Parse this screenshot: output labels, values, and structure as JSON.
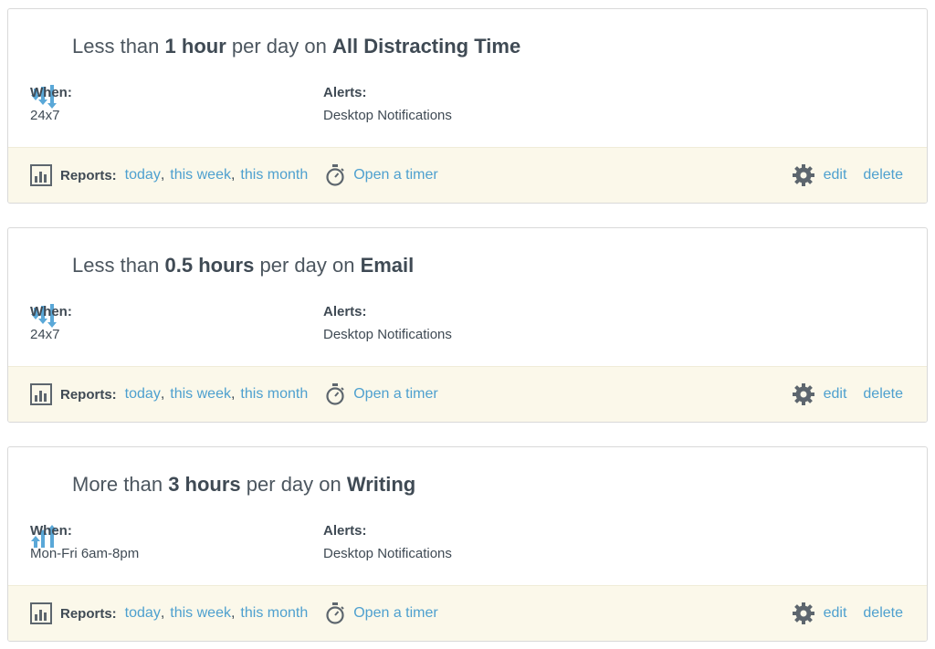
{
  "colors": {
    "accent_link": "#4ea0cf",
    "footer_bg": "#fbf8ea",
    "icon_blue": "#5aa8d8",
    "icon_gray": "#5d666e"
  },
  "footer": {
    "reports_label": "Reports:",
    "today": "today",
    "this_week": "this week",
    "this_month": "this month",
    "comma": ",",
    "open_timer": "Open a timer",
    "edit": "edit",
    "delete": "delete"
  },
  "labels": {
    "when": "When:",
    "alerts": "Alerts:"
  },
  "goals": [
    {
      "direction_icon": "arrows-down-icon",
      "comparison": "Less than",
      "amount": "1 hour",
      "middle": "per day on",
      "category": "All Distracting Time",
      "when": "24x7",
      "alerts": "Desktop Notifications"
    },
    {
      "direction_icon": "arrows-down-icon",
      "comparison": "Less than",
      "amount": "0.5 hours",
      "middle": "per day on",
      "category": "Email",
      "when": "24x7",
      "alerts": "Desktop Notifications"
    },
    {
      "direction_icon": "arrows-up-icon",
      "comparison": "More than",
      "amount": "3 hours",
      "middle": "per day on",
      "category": "Writing",
      "when": "Mon-Fri 6am-8pm",
      "alerts": "Desktop Notifications"
    }
  ]
}
